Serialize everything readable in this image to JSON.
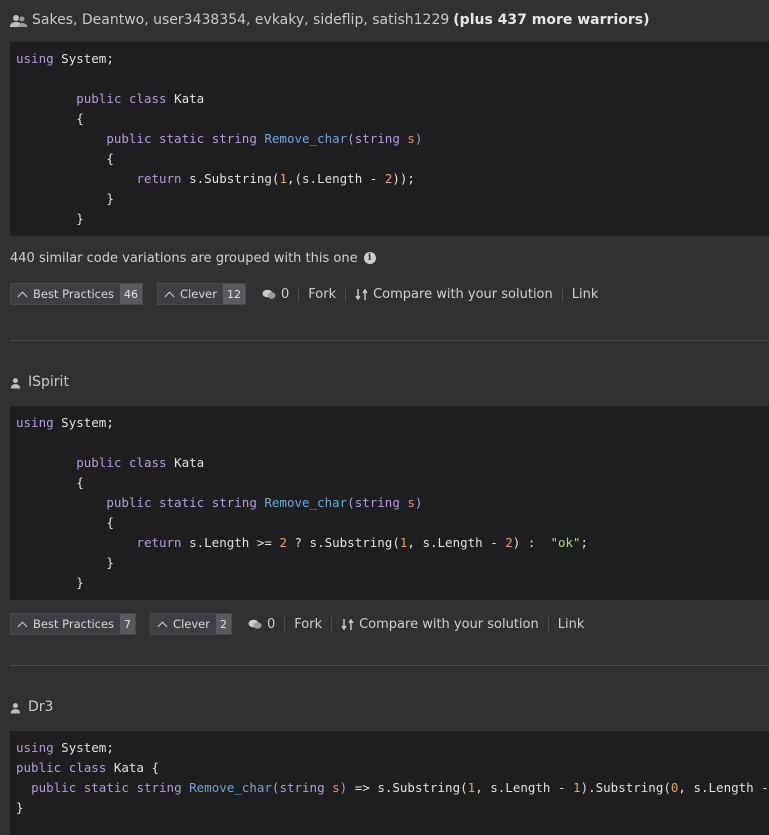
{
  "solutions": [
    {
      "authors_text": "Sakes, Deantwo, user3438354, evkaky, sideflip, satish1229",
      "more_text": "(plus 437 more warriors)",
      "note": "440 similar code variations are grouped with this one",
      "best_practices_label": "Best Practices",
      "best_practices_count": "46",
      "clever_label": "Clever",
      "clever_count": "12",
      "comments_count": "0",
      "fork_label": "Fork",
      "compare_label": "Compare with your solution",
      "link_label": "Link"
    },
    {
      "authors_text": "ISpirit",
      "best_practices_label": "Best Practices",
      "best_practices_count": "7",
      "clever_label": "Clever",
      "clever_count": "2",
      "comments_count": "0",
      "fork_label": "Fork",
      "compare_label": "Compare with your solution",
      "link_label": "Link"
    },
    {
      "authors_text": "Dr3"
    }
  ],
  "code": {
    "using": "using",
    "system": "System;",
    "public": "public",
    "class": "class",
    "static": "static",
    "string": "string",
    "return": "return",
    "kata": "Kata",
    "open_brace": "{",
    "close_brace": "}",
    "fn": "Remove_char",
    "param": "s",
    "paren_open": "(",
    "paren_close": ")",
    "substring": "s.Substring",
    "s_length": "s.Length",
    "s_length_gte": "s.Length >=",
    "ok": "\"ok\"",
    "arrow": "=>",
    "n0": "0",
    "n1": "1",
    "n2": "2"
  },
  "icons": {
    "group": "users-icon",
    "user": "user-icon",
    "info": "info-icon",
    "chevron": "chevron-up-icon",
    "comment": "comment-icon",
    "compare": "compare-icon"
  }
}
